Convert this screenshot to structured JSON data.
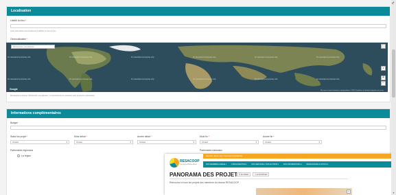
{
  "localisation": {
    "header": "Localisation",
    "libelle_label": "Libellé du lieu",
    "libelle_value": "",
    "libelle_help": "Cette information sera seulement à afficher le nom du lieu",
    "geo_label": "Géolocalisation",
    "map_search_placeholder": "Rechercher une adresse",
    "tile_text": "For development purposes only",
    "google": "Google",
    "map_footer": "Raccourcis clavier  Données cartographiques ©2023  Conditions d'utilisation  Signaler une erreur",
    "map_help": "Renseignez la champ \"Rechercher une adresse\", et repositionnez le marqueur avec la souris si nécessaire",
    "fullscreen_icon": "fullscreen-icon",
    "zoom_in": "+",
    "zoom_out": "−"
  },
  "infos": {
    "header": "Informations complémentaires",
    "budget_label": "Budget",
    "statut_label": "Statut du projet",
    "mois_debut_label": "Mois début",
    "annee_debut_label": "Année début",
    "mois_fin_label": "Mois fin",
    "annee_fin_label": "Année fin",
    "choose": "Choisir",
    "partenaires_regionaux_label": "Partenaires régionaux",
    "la_region_label": "La région",
    "partenaires_nationaux_label": "Partenaires nationaux"
  },
  "popup": {
    "top_bar": "Résoudre. Réunir. Agir. Coopération Internationale",
    "logo_text": "RESACOOP",
    "logo_sub": "Auvergne-Rhône-Alpes",
    "nav": [
      "NOS MEMBRES ADEGE ▾",
      "L'ORGANISATION ▾",
      "NOS SERVICES / NOS ACTIONS ▾",
      "NOS INFORMATIONS ▾",
      "RESSOURCES & OUTILS ▾"
    ],
    "title": "PANORAMA DES PROJETS",
    "filter_btn": "FILTRER",
    "export_btn": "EXPORTER",
    "text": "Retrouvez ici tous les projets des membres du réseau RESACOOP",
    "zoom_in": "+"
  },
  "colors": {
    "accent": "#0b8a9a",
    "orange": "#f5a623"
  }
}
